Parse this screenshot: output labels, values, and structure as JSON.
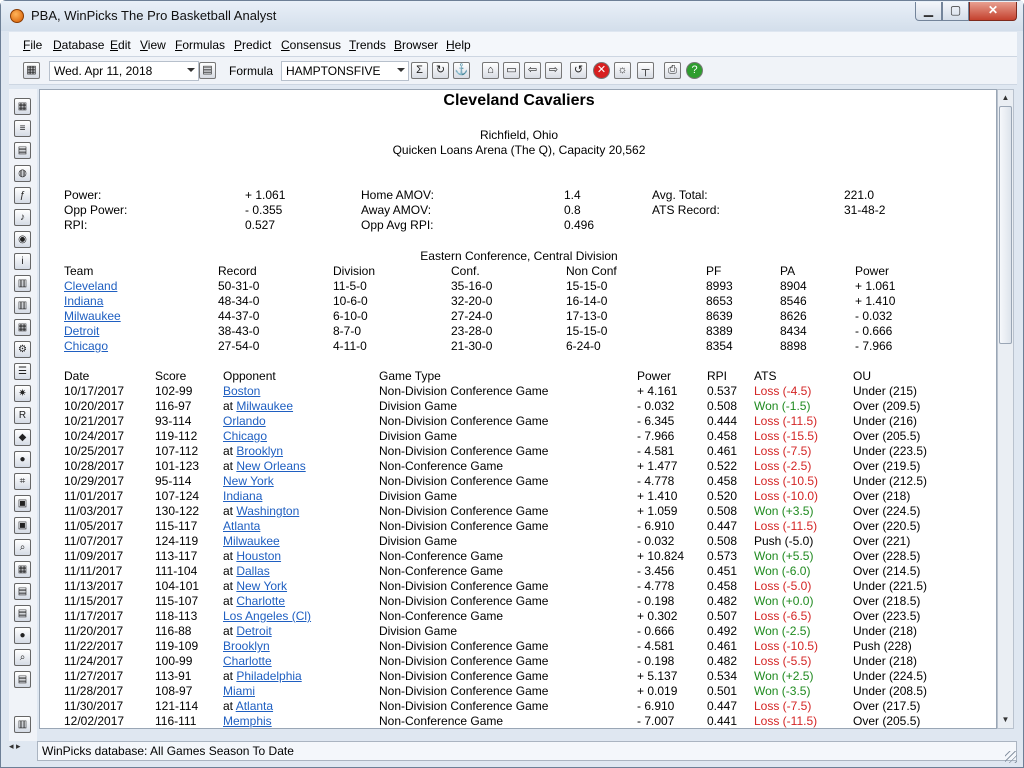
{
  "window": {
    "title": "PBA, WinPicks  The Pro Basketball Analyst"
  },
  "menu": [
    "File",
    "Database",
    "Edit",
    "View",
    "Formulas",
    "Predict",
    "Consensus",
    "Trends",
    "Browser",
    "Help"
  ],
  "menu_underline": [
    "F",
    "D",
    "E",
    "V",
    "F",
    "P",
    "C",
    "T",
    "B",
    "H"
  ],
  "toolbar": {
    "date": "Wed. Apr 11, 2018",
    "formula_label": "Formula",
    "formula": "HAMPTONSFIVE",
    "icons": [
      "calendar-icon",
      "calendar-go-icon",
      "sigma-icon",
      "refresh-icon",
      "anchor-icon",
      "home-icon",
      "folder-icon",
      "back-arrow-icon",
      "forward-arrow-icon",
      "document-refresh-icon",
      "stop-icon",
      "wizard-icon",
      "ruler-icon",
      "print-icon",
      "help-icon"
    ]
  },
  "sidebar": {
    "icons": [
      "grid-icon",
      "list-icon",
      "document-icon",
      "globe-icon",
      "formula-icon",
      "music-icon",
      "globe-network-icon",
      "info-icon",
      "table-icon",
      "table-alt-icon",
      "table-grid-icon",
      "settings-icon",
      "list-alt-icon",
      "lightbulb-icon",
      "rpi-icon",
      "tag-icon",
      "ball-icon",
      "chart-icon",
      "document-copy-icon",
      "document-move-icon",
      "zoom-icon",
      "calculator-icon",
      "copy-icon",
      "pages-icon",
      "save-icon",
      "find-icon",
      "paste-icon",
      "book-icon"
    ]
  },
  "team": {
    "name": "Cleveland Cavaliers",
    "city": "Richfield, Ohio",
    "arena": "Quicken Loans Arena (The Q), Capacity 20,562"
  },
  "stats": {
    "col1": [
      {
        "label": "Power:",
        "value": "+ 1.061"
      },
      {
        "label": "Opp Power:",
        "value": "- 0.355"
      },
      {
        "label": "RPI:",
        "value": "0.527"
      }
    ],
    "col2": [
      {
        "label": "Home AMOV:",
        "value": "1.4"
      },
      {
        "label": "Away AMOV:",
        "value": "0.8"
      },
      {
        "label": "Opp Avg RPI:",
        "value": "0.496"
      }
    ],
    "col3": [
      {
        "label": "Avg. Total:",
        "value": "221.0"
      },
      {
        "label": "ATS Record:",
        "value": "31-48-2"
      }
    ]
  },
  "division": {
    "title": "Eastern Conference, Central Division",
    "headers": [
      "Team",
      "Record",
      "Division",
      "Conf.",
      "Non Conf",
      "PF",
      "PA",
      "Power"
    ],
    "rows": [
      [
        "Cleveland",
        "50-31-0",
        "11-5-0",
        "35-16-0",
        "15-15-0",
        "8993",
        "8904",
        "+ 1.061"
      ],
      [
        "Indiana",
        "48-34-0",
        "10-6-0",
        "32-20-0",
        "16-14-0",
        "8653",
        "8546",
        "+ 1.410"
      ],
      [
        "Milwaukee",
        "44-37-0",
        "6-10-0",
        "27-24-0",
        "17-13-0",
        "8639",
        "8626",
        "- 0.032"
      ],
      [
        "Detroit",
        "38-43-0",
        "8-7-0",
        "23-28-0",
        "15-15-0",
        "8389",
        "8434",
        "- 0.666"
      ],
      [
        "Chicago",
        "27-54-0",
        "4-11-0",
        "21-30-0",
        "6-24-0",
        "8354",
        "8898",
        "- 7.966"
      ]
    ]
  },
  "games": {
    "headers": [
      "Date",
      "Score",
      "Opponent",
      "Game Type",
      "Power",
      "RPI",
      "ATS",
      "OU"
    ],
    "rows": [
      [
        "10/17/2017",
        "102-99",
        "",
        "Boston",
        "Non-Division Conference Game",
        "+ 4.161",
        "0.537",
        "Loss (-4.5)",
        "Under (215)"
      ],
      [
        "10/20/2017",
        "116-97",
        "at ",
        "Milwaukee",
        "Division Game",
        "- 0.032",
        "0.508",
        "Won (-1.5)",
        "Over (209.5)"
      ],
      [
        "10/21/2017",
        "93-114",
        "",
        "Orlando",
        "Non-Division Conference Game",
        "- 6.345",
        "0.444",
        "Loss (-11.5)",
        "Under (216)"
      ],
      [
        "10/24/2017",
        "119-112",
        "",
        "Chicago",
        "Division Game",
        "- 7.966",
        "0.458",
        "Loss (-15.5)",
        "Over (205.5)"
      ],
      [
        "10/25/2017",
        "107-112",
        "at ",
        "Brooklyn",
        "Non-Division Conference Game",
        "- 4.581",
        "0.461",
        "Loss (-7.5)",
        "Under (223.5)"
      ],
      [
        "10/28/2017",
        "101-123",
        "at ",
        "New Orleans",
        "Non-Conference Game",
        "+ 1.477",
        "0.522",
        "Loss (-2.5)",
        "Over (219.5)"
      ],
      [
        "10/29/2017",
        "95-114",
        "",
        "New York",
        "Non-Division Conference Game",
        "- 4.778",
        "0.458",
        "Loss (-10.5)",
        "Under (212.5)"
      ],
      [
        "11/01/2017",
        "107-124",
        "",
        "Indiana",
        "Division Game",
        "+ 1.410",
        "0.520",
        "Loss (-10.0)",
        "Over (218)"
      ],
      [
        "11/03/2017",
        "130-122",
        "at ",
        "Washington",
        "Non-Division Conference Game",
        "+ 1.059",
        "0.508",
        "Won (+3.5)",
        "Over (224.5)"
      ],
      [
        "11/05/2017",
        "115-117",
        "",
        "Atlanta",
        "Non-Division Conference Game",
        "- 6.910",
        "0.447",
        "Loss (-11.5)",
        "Over (220.5)"
      ],
      [
        "11/07/2017",
        "124-119",
        "",
        "Milwaukee",
        "Division Game",
        "- 0.032",
        "0.508",
        "Push (-5.0)",
        "Over (221)"
      ],
      [
        "11/09/2017",
        "113-117",
        "at ",
        "Houston",
        "Non-Conference Game",
        "+ 10.824",
        "0.573",
        "Won (+5.5)",
        "Over (228.5)"
      ],
      [
        "11/11/2017",
        "111-104",
        "at ",
        "Dallas",
        "Non-Conference Game",
        "- 3.456",
        "0.451",
        "Won (-6.0)",
        "Over (214.5)"
      ],
      [
        "11/13/2017",
        "104-101",
        "at ",
        "New York",
        "Non-Division Conference Game",
        "- 4.778",
        "0.458",
        "Loss (-5.0)",
        "Under (221.5)"
      ],
      [
        "11/15/2017",
        "115-107",
        "at ",
        "Charlotte",
        "Non-Division Conference Game",
        "- 0.198",
        "0.482",
        "Won (+0.0)",
        "Over (218.5)"
      ],
      [
        "11/17/2017",
        "118-113",
        "",
        "Los Angeles (Cl)",
        "Non-Conference Game",
        "+ 0.302",
        "0.507",
        "Loss (-6.5)",
        "Over (223.5)"
      ],
      [
        "11/20/2017",
        "116-88",
        "at ",
        "Detroit",
        "Division Game",
        "- 0.666",
        "0.492",
        "Won (-2.5)",
        "Under (218)"
      ],
      [
        "11/22/2017",
        "119-109",
        "",
        "Brooklyn",
        "Non-Division Conference Game",
        "- 4.581",
        "0.461",
        "Loss (-10.5)",
        "Push (228)"
      ],
      [
        "11/24/2017",
        "100-99",
        "",
        "Charlotte",
        "Non-Division Conference Game",
        "- 0.198",
        "0.482",
        "Loss (-5.5)",
        "Under (218)"
      ],
      [
        "11/27/2017",
        "113-91",
        "at ",
        "Philadelphia",
        "Non-Division Conference Game",
        "+ 5.137",
        "0.534",
        "Won (+2.5)",
        "Under (224.5)"
      ],
      [
        "11/28/2017",
        "108-97",
        "",
        "Miami",
        "Non-Division Conference Game",
        "+ 0.019",
        "0.501",
        "Won (-3.5)",
        "Under (208.5)"
      ],
      [
        "11/30/2017",
        "121-114",
        "at ",
        "Atlanta",
        "Non-Division Conference Game",
        "- 6.910",
        "0.447",
        "Loss (-7.5)",
        "Over (217.5)"
      ],
      [
        "12/02/2017",
        "116-111",
        "",
        "Memphis",
        "Non-Conference Game",
        "- 7.007",
        "0.441",
        "Loss (-11.5)",
        "Over (205.5)"
      ]
    ]
  },
  "status": {
    "text": "WinPicks database:  All Games Season To Date"
  },
  "colors": {
    "link": "#1f5fc1",
    "won": "#1f8a1f",
    "loss": "#d42424",
    "titlebar": "#dfe7f1"
  }
}
